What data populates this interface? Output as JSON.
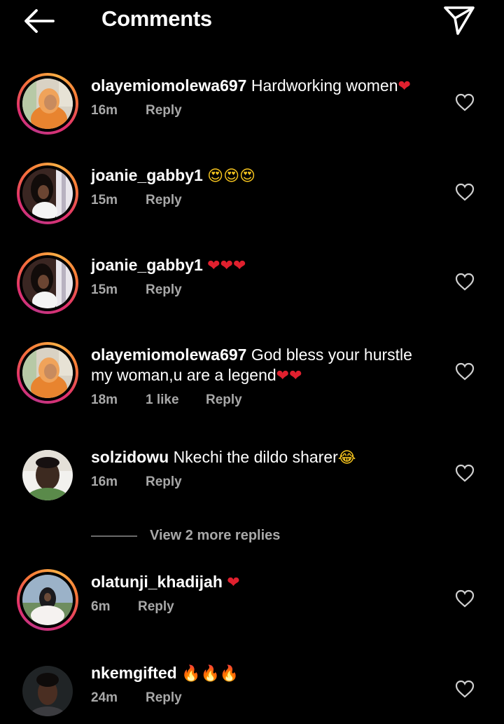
{
  "header": {
    "title": "Comments"
  },
  "comments": [
    {
      "user": "olayemiomolewa697",
      "text": "Hardworking women",
      "emoji": "❤",
      "time": "16m",
      "likes": "",
      "reply": "Reply"
    },
    {
      "user": "joanie_gabby1",
      "text": "",
      "emoji": "😍😍😍",
      "time": "15m",
      "likes": "",
      "reply": "Reply"
    },
    {
      "user": "joanie_gabby1",
      "text": "",
      "emoji": "❤❤❤",
      "time": "15m",
      "likes": "",
      "reply": "Reply"
    },
    {
      "user": "olayemiomolewa697",
      "text": "God bless your hurstle my woman,u are a legend",
      "emoji": "❤❤",
      "time": "18m",
      "likes": "1 like",
      "reply": "Reply"
    },
    {
      "user": "solzidowu",
      "text": "Nkechi the dildo sharer",
      "emoji": "😂",
      "time": "16m",
      "likes": "",
      "reply": "Reply"
    },
    {
      "user": "olatunji_khadijah",
      "text": "",
      "emoji": "❤",
      "time": "6m",
      "likes": "",
      "reply": "Reply"
    },
    {
      "user": "nkemgifted",
      "text": "",
      "emoji": "🔥🔥🔥",
      "time": "24m",
      "likes": "",
      "reply": "Reply"
    }
  ],
  "view_more": "View 2 more replies",
  "icons": {
    "back": "back-arrow-icon",
    "send": "paper-plane-icon",
    "like": "heart-outline-icon"
  },
  "colors": {
    "background": "#000000",
    "text": "#ffffff",
    "secondary": "#a8a8a8",
    "story_ring": "#e1306c"
  }
}
